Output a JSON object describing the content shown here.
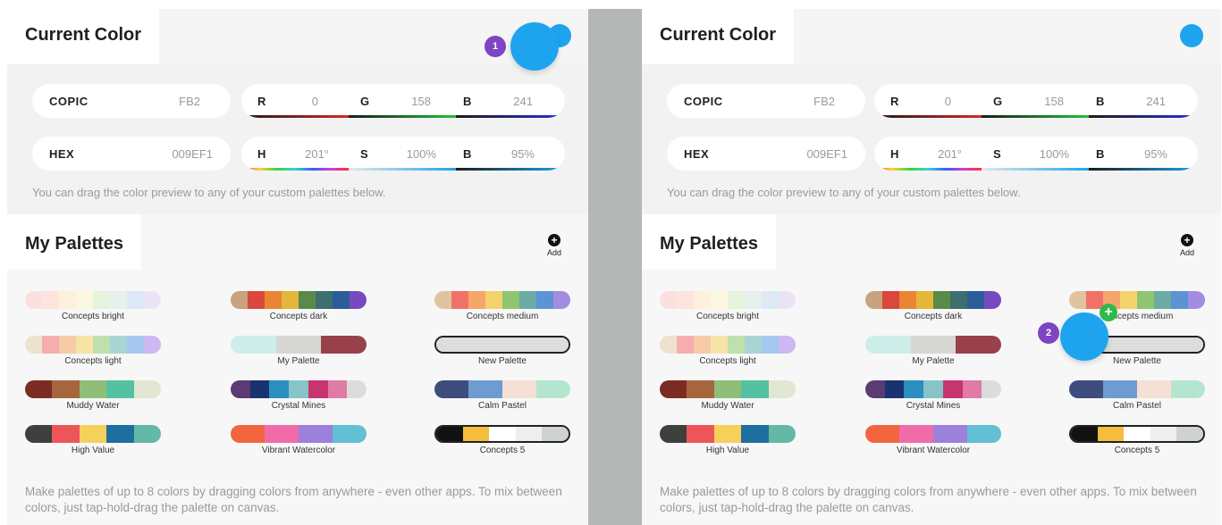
{
  "swatch_color": "#1ea4ee",
  "current_color": {
    "title": "Current Color",
    "copic_label": "COPIC",
    "copic_value": "FB2",
    "hex_label": "HEX",
    "hex_value": "009EF1",
    "r_label": "R",
    "r_value": "0",
    "g_label": "G",
    "g_value": "158",
    "b_label": "B",
    "b_value": "241",
    "h_label": "H",
    "h_value": "201°",
    "s_label": "S",
    "s_value": "100%",
    "v_label": "B",
    "v_value": "95%",
    "hint": "You can drag the color preview to any of your custom palettes below."
  },
  "palettes": {
    "title": "My Palettes",
    "add_label": "Add",
    "add_icon": "plus-circle-icon",
    "footer": "Make palettes of up to 8 colors by dragging colors from anywhere - even other apps. To mix between colors, just tap-hold-drag the palette on canvas.",
    "items": [
      {
        "name": "Concepts bright",
        "colors": [
          "#fbe0e0",
          "#fde4dc",
          "#fdf0dc",
          "#fbf7e0",
          "#e4f3dc",
          "#e6f1ee",
          "#dde9f6",
          "#ece4f6"
        ]
      },
      {
        "name": "Concepts dark",
        "colors": [
          "#c9a27e",
          "#d9483b",
          "#ea8534",
          "#e5b73a",
          "#5a8a48",
          "#3d6e70",
          "#2b5e98",
          "#7749c0"
        ]
      },
      {
        "name": "Concepts medium",
        "colors": [
          "#e2c3a0",
          "#f27167",
          "#f7a66b",
          "#f3d36e",
          "#8fc56f",
          "#6caaa6",
          "#5a94d3",
          "#a38de0"
        ]
      },
      {
        "name": "Concepts light",
        "colors": [
          "#efe1cf",
          "#f6adb0",
          "#f7cba7",
          "#f6e4a7",
          "#bfe0ac",
          "#a9d5d4",
          "#a6c8ee",
          "#cdb8f2"
        ]
      },
      {
        "name": "My Palette",
        "colors": [
          "#cdeee9",
          "#d7d8d3",
          "#98414b"
        ]
      },
      {
        "name": "New Palette",
        "colors": [
          "#dcdedd"
        ]
      },
      {
        "name": "Muddy Water",
        "colors": [
          "#7d2c23",
          "#a5663e",
          "#8fbf77",
          "#54c1a0",
          "#e1e7d3"
        ]
      },
      {
        "name": "Crystal Mines",
        "colors": [
          "#5c3a74",
          "#1a326e",
          "#2b8fbf",
          "#86c4c8",
          "#c7356f",
          "#e07aa6",
          "#dddcdc"
        ]
      },
      {
        "name": "Calm Pastel",
        "colors": [
          "#3e4c7e",
          "#6f9bd1",
          "#f5e0d6",
          "#b4e6cf"
        ]
      },
      {
        "name": "High Value",
        "colors": [
          "#3e403e",
          "#ee5558",
          "#f6d15a",
          "#1d6f9e",
          "#64b9a6"
        ]
      },
      {
        "name": "Vibrant Watercolor",
        "colors": [
          "#f3653f",
          "#f06ca8",
          "#9d7fdc",
          "#63bfd3"
        ]
      },
      {
        "name": "Concepts 5",
        "colors": [
          "#121212",
          "#f5bd3e",
          "#ffffff",
          "#edeeee",
          "#cfd2d2"
        ]
      }
    ]
  },
  "steps": {
    "one": "1",
    "two": "2"
  },
  "drop_plus": "+"
}
